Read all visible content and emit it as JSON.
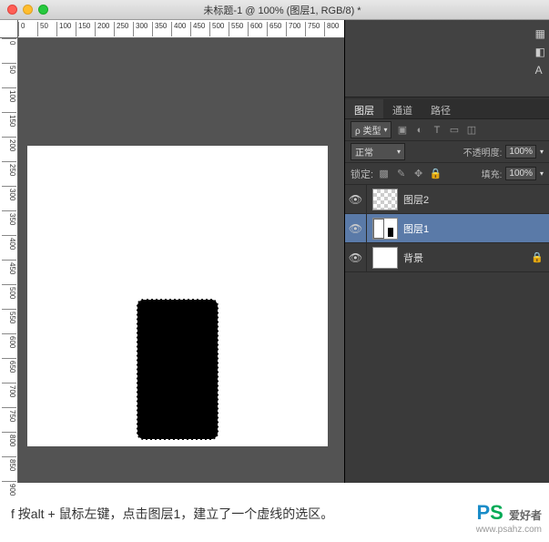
{
  "titlebar": {
    "title": "未标题-1 @ 100% (图层1, RGB/8) *"
  },
  "ruler_h": [
    "0",
    "50",
    "100",
    "150",
    "200",
    "250",
    "300",
    "350",
    "400",
    "450",
    "500",
    "550",
    "600",
    "650",
    "700",
    "750",
    "800"
  ],
  "ruler_v": [
    "0",
    "50",
    "100",
    "150",
    "200",
    "250",
    "300",
    "350",
    "400",
    "450",
    "500",
    "550",
    "600",
    "650",
    "700",
    "750",
    "800",
    "850",
    "900"
  ],
  "panel": {
    "tabs": {
      "layers": "图层",
      "channels": "通道",
      "paths": "路径"
    },
    "filter_label": "ρ 类型",
    "blend": "正常",
    "opacity_label": "不透明度:",
    "opacity_value": "100%",
    "lock_label": "锁定:",
    "fill_label": "填充:",
    "fill_value": "100%"
  },
  "layers": [
    {
      "name": "图层2",
      "thumb": "l2",
      "selected": false,
      "locked": false
    },
    {
      "name": "图层1",
      "thumb": "l1",
      "selected": true,
      "locked": false
    },
    {
      "name": "背景",
      "thumb": "bg",
      "selected": false,
      "locked": true
    }
  ],
  "caption": "f 按alt + 鼠标左键，点击图层1，建立了一个虚线的选区。",
  "watermark": {
    "logo_p": "P",
    "logo_s": "S",
    "zh": "爱好者",
    "url": "www.psahz.com"
  }
}
